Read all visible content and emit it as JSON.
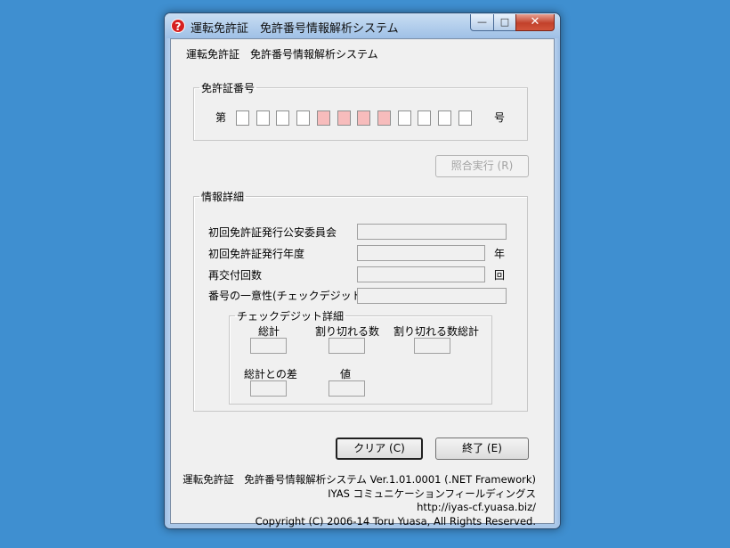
{
  "window": {
    "title": "運転免許証　免許番号情報解析システム",
    "icon": "question-icon",
    "controls": {
      "minimize": "—",
      "maximize": "□",
      "close": "✕"
    }
  },
  "header_title": "運転免許証　免許番号情報解析システム",
  "license_group": {
    "legend": "免許証番号",
    "prefix": "第",
    "suffix": "号",
    "digit_count": 12,
    "highlighted_digits": [
      5,
      6,
      7,
      8
    ]
  },
  "verify_button": {
    "label": "照合実行 (R)"
  },
  "info_group": {
    "legend": "情報詳細",
    "rows": [
      {
        "label": "初回免許証発行公安委員会",
        "value": "",
        "unit": ""
      },
      {
        "label": "初回免許証発行年度",
        "value": "",
        "unit": "年"
      },
      {
        "label": "再交付回数",
        "value": "",
        "unit": "回"
      },
      {
        "label": "番号の一意性(チェックデジット)",
        "value": "",
        "unit": ""
      }
    ]
  },
  "check_group": {
    "legend": "チェックデジット詳細",
    "total_label": "総計",
    "divisible_label": "割り切れる数",
    "divisible_total_label": "割り切れる数総計",
    "diff_label": "総計との差",
    "value_label": "値"
  },
  "buttons": {
    "clear": "クリア (C)",
    "exit": "終了 (E)"
  },
  "footer": {
    "line1": "運転免許証　免許番号情報解析システム Ver.1.01.0001 (.NET Framework)",
    "line2": "IYAS コミュニケーションフィールディングス",
    "line3": "http://iyas-cf.yuasa.biz/",
    "line4": "Copyright (C) 2006-14 Toru Yuasa, All Rights Reserved."
  },
  "colors": {
    "desktop": "#3f8fd0",
    "highlight_digit": "#f7bcbc",
    "dialog_bg": "#f0f0f0"
  }
}
